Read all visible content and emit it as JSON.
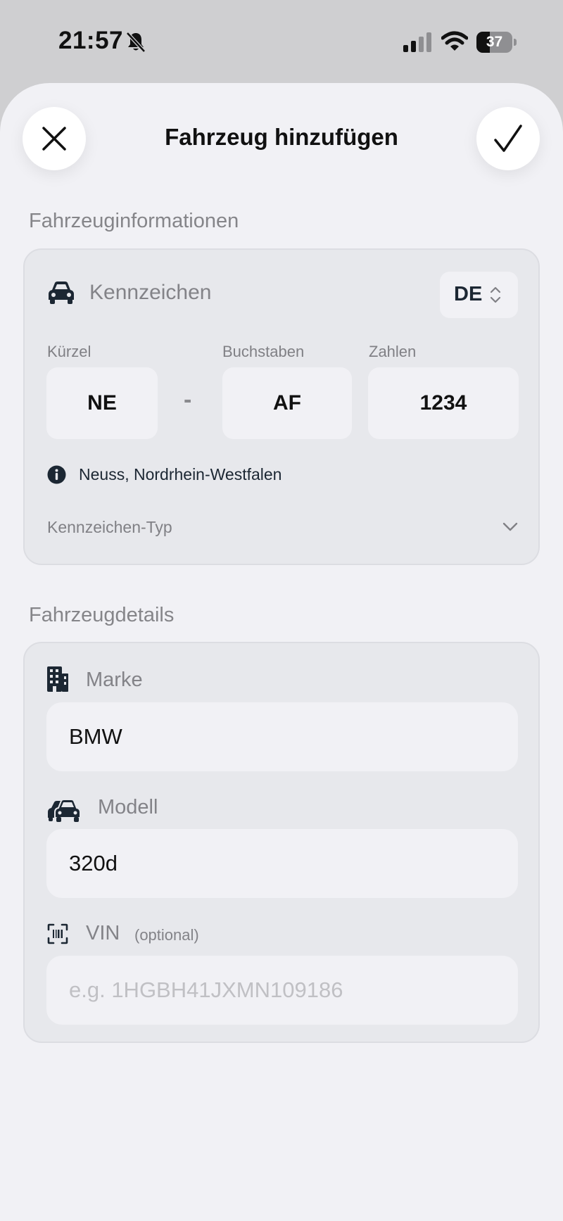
{
  "status_bar": {
    "time": "21:57",
    "battery_level": "37",
    "battery_fraction": 0.37
  },
  "header": {
    "title": "Fahrzeug hinzufügen",
    "close_icon": "close-icon",
    "confirm_icon": "checkmark-icon"
  },
  "vehicle_info": {
    "section_title": "Fahrzeuginformationen",
    "plate_label": "Kennzeichen",
    "plate_icon": "car-icon",
    "country": "DE",
    "district_caption": "Kürzel",
    "district_value": "NE",
    "separator": "-",
    "letters_caption": "Buchstaben",
    "letters_value": "AF",
    "numbers_caption": "Zahlen",
    "numbers_value": "1234",
    "location_info": "Neuss, Nordrhein-Westfalen",
    "plate_type_label": "Kennzeichen-Typ"
  },
  "vehicle_details": {
    "section_title": "Fahrzeugdetails",
    "brand_label": "Marke",
    "brand_icon": "building-icon",
    "brand_value": "BMW",
    "model_label": "Modell",
    "model_icon": "cars-icon",
    "model_value": "320d",
    "vin_label": "VIN",
    "vin_hint": "(optional)",
    "vin_icon": "barcode-scan-icon",
    "vin_placeholder": "e.g. 1HGBH41JXMN109186",
    "vin_value": ""
  }
}
